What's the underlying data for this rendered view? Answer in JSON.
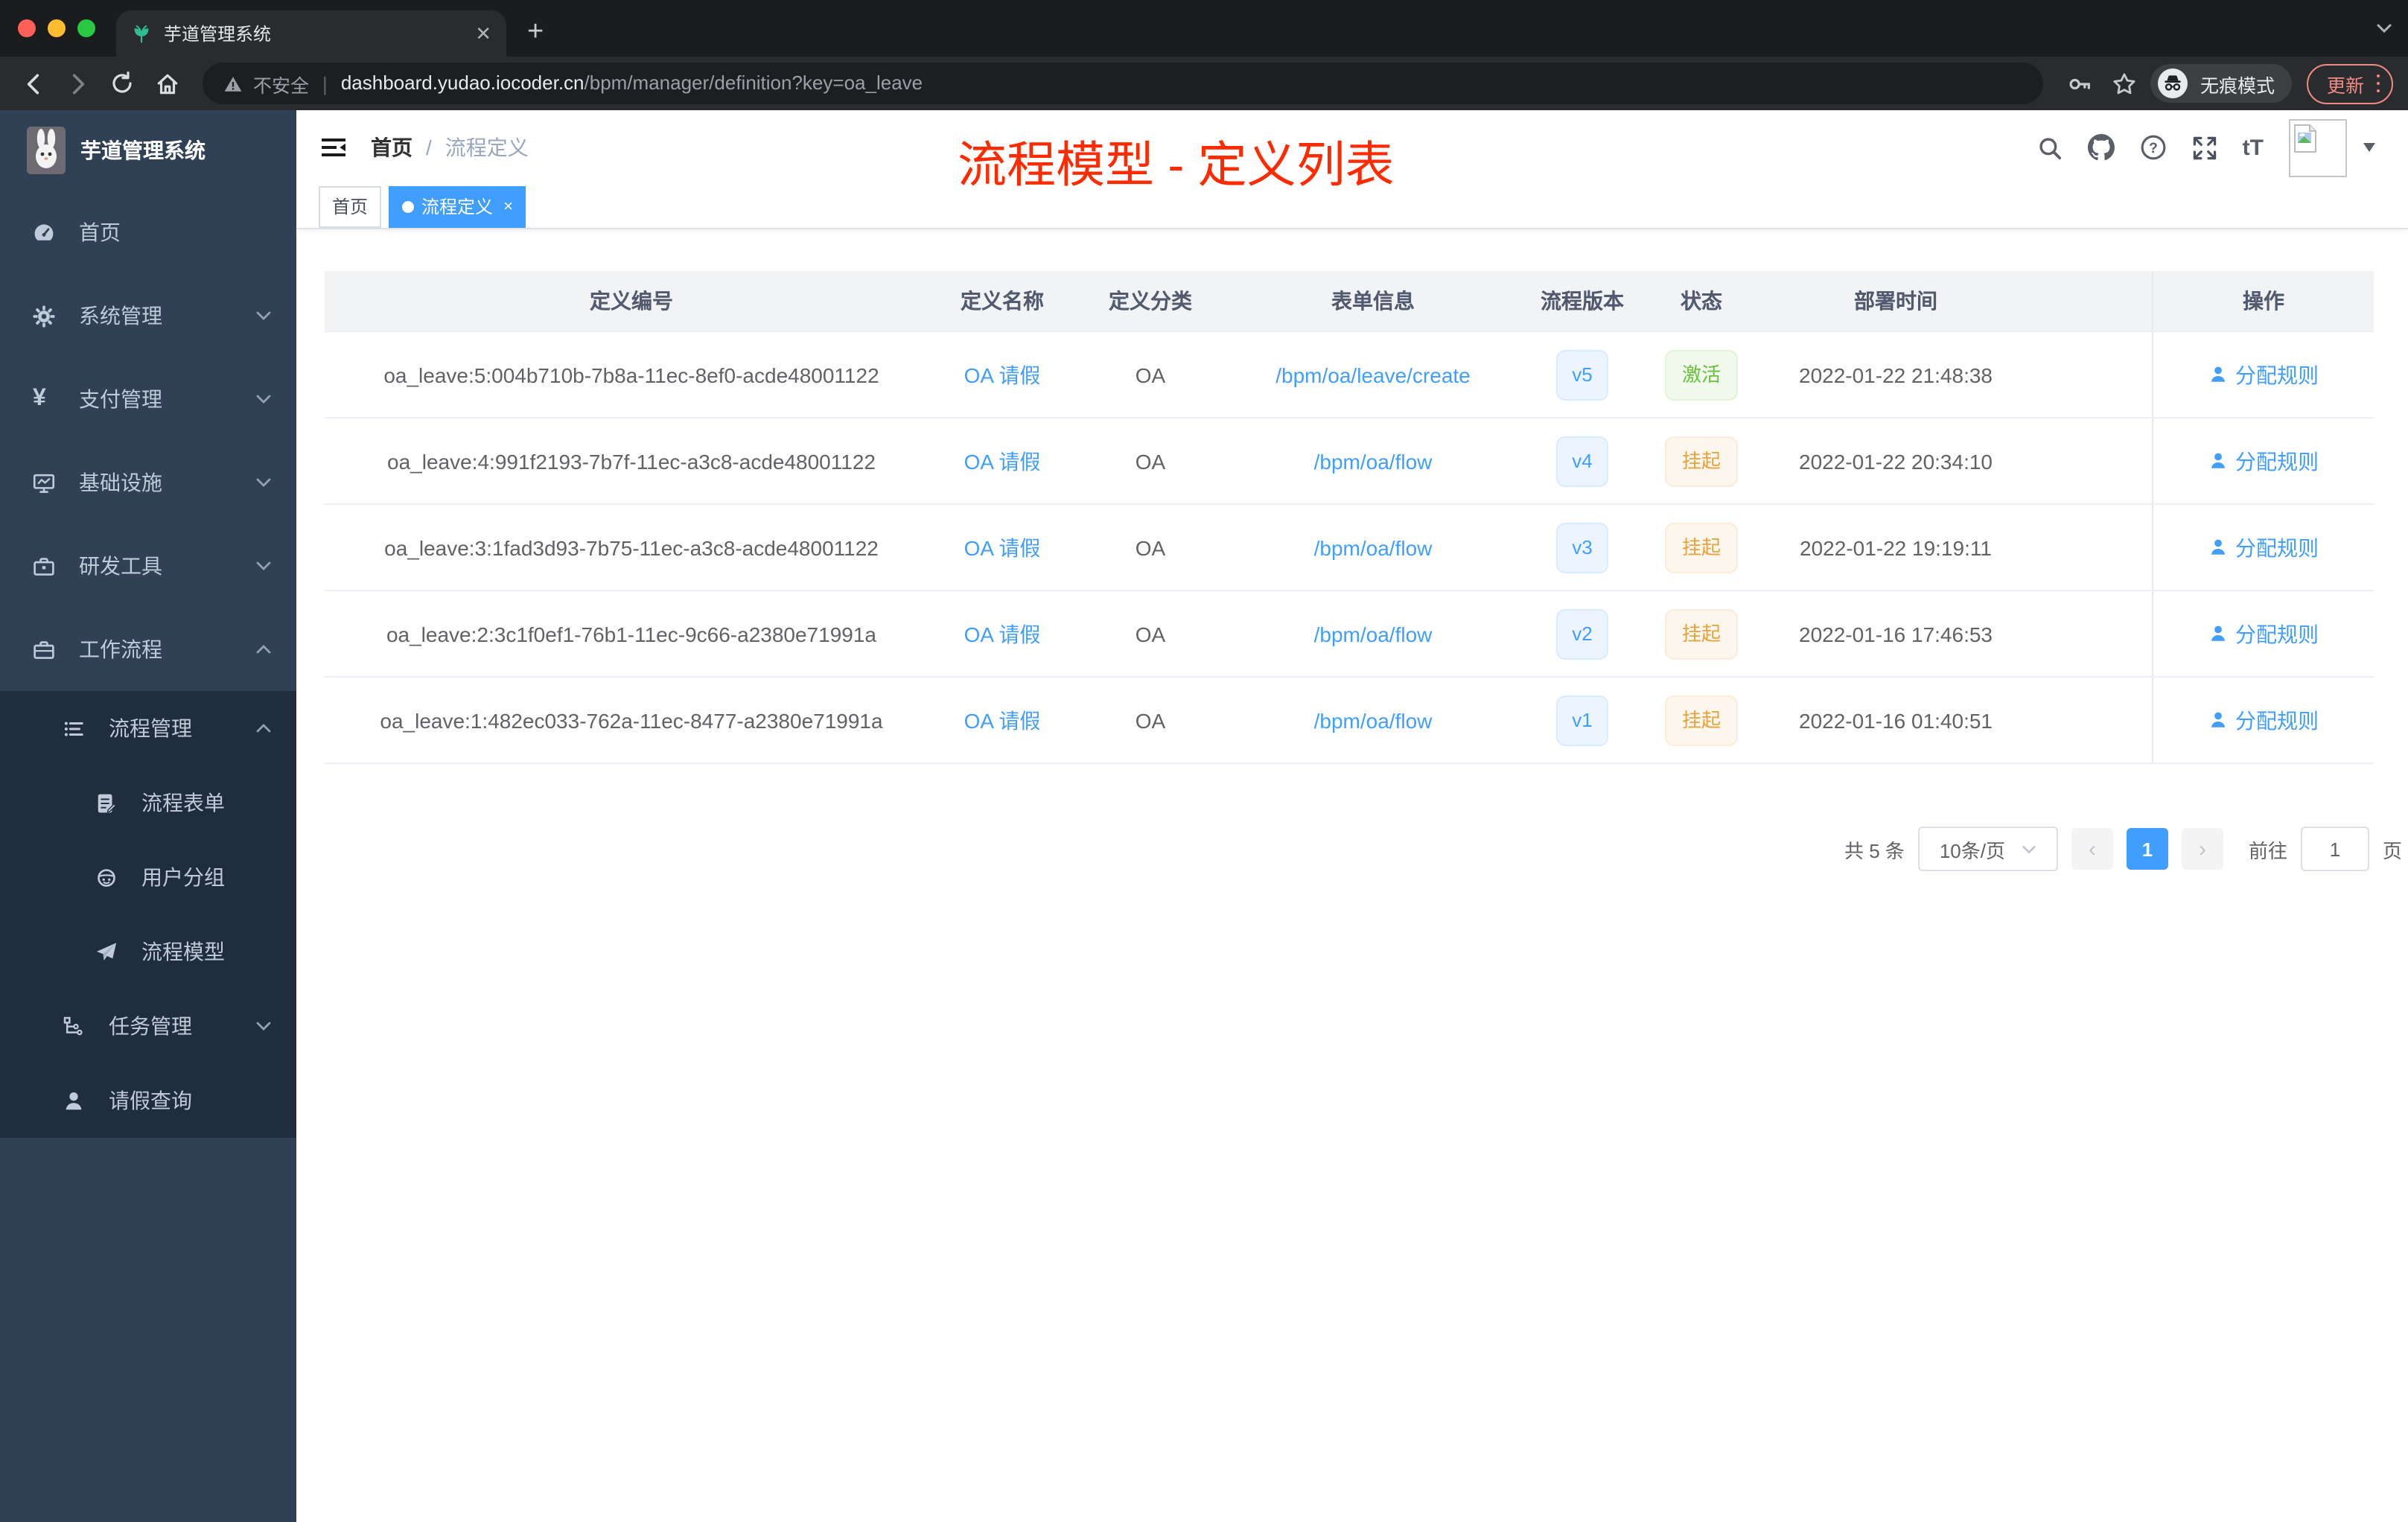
{
  "colors": {
    "accent": "#409eff",
    "annotation_red": "#ff2a00",
    "status_active_green": "#67c23a",
    "status_suspend_orange": "#e6a23c",
    "sidebar_bg": "#304156",
    "submenu_bg": "#1f2d3d"
  },
  "browser": {
    "tab_title": "芋道管理系统",
    "new_tab": "+",
    "security_warning": "不安全",
    "url_domain": "dashboard.yudao.iocoder.cn",
    "url_path": "/bpm/manager/definition?key=oa_leave",
    "incognito_label": "无痕模式",
    "update_label": "更新"
  },
  "sidebar": {
    "logo_title": "芋道管理系统",
    "items": [
      {
        "label": "首页",
        "icon": "dashboard-icon"
      },
      {
        "label": "系统管理",
        "icon": "gear-icon"
      },
      {
        "label": "支付管理",
        "icon": "yen-icon"
      },
      {
        "label": "基础设施",
        "icon": "monitor-icon"
      },
      {
        "label": "研发工具",
        "icon": "toolbox-icon"
      },
      {
        "label": "工作流程",
        "icon": "briefcase-icon"
      }
    ],
    "yen_glyph": "¥",
    "submenu": {
      "group_label": "流程管理",
      "children": [
        {
          "label": "流程表单",
          "icon": "form-icon"
        },
        {
          "label": "用户分组",
          "icon": "user-group-icon"
        },
        {
          "label": "流程模型",
          "icon": "paper-plane-icon"
        }
      ],
      "siblings": [
        {
          "label": "任务管理",
          "icon": "tree-icon"
        },
        {
          "label": "请假查询",
          "icon": "person-icon"
        }
      ]
    }
  },
  "navbar": {
    "breadcrumb": [
      "首页",
      "流程定义"
    ],
    "breadcrumb_separator": "/",
    "font_size_icon_label": "tT"
  },
  "annotation": {
    "text": "流程模型 - 定义列表"
  },
  "tags": [
    {
      "label": "首页"
    },
    {
      "label": "流程定义",
      "close": "×"
    }
  ],
  "table": {
    "headers": [
      "定义编号",
      "定义名称",
      "定义分类",
      "表单信息",
      "流程版本",
      "状态",
      "部署时间",
      "操作"
    ],
    "rows": [
      {
        "id": "oa_leave:5:004b710b-7b8a-11ec-8ef0-acde48001122",
        "name": "OA 请假",
        "category": "OA",
        "form": "/bpm/oa/leave/create",
        "version": "v5",
        "status": "激活",
        "status_type": "success",
        "deploy_time": "2022-01-22 21:48:38",
        "action": "分配规则"
      },
      {
        "id": "oa_leave:4:991f2193-7b7f-11ec-a3c8-acde48001122",
        "name": "OA 请假",
        "category": "OA",
        "form": "/bpm/oa/flow",
        "version": "v4",
        "status": "挂起",
        "status_type": "warning",
        "deploy_time": "2022-01-22 20:34:10",
        "action": "分配规则"
      },
      {
        "id": "oa_leave:3:1fad3d93-7b75-11ec-a3c8-acde48001122",
        "name": "OA 请假",
        "category": "OA",
        "form": "/bpm/oa/flow",
        "version": "v3",
        "status": "挂起",
        "status_type": "warning",
        "deploy_time": "2022-01-22 19:19:11",
        "action": "分配规则"
      },
      {
        "id": "oa_leave:2:3c1f0ef1-76b1-11ec-9c66-a2380e71991a",
        "name": "OA 请假",
        "category": "OA",
        "form": "/bpm/oa/flow",
        "version": "v2",
        "status": "挂起",
        "status_type": "warning",
        "deploy_time": "2022-01-16 17:46:53",
        "action": "分配规则"
      },
      {
        "id": "oa_leave:1:482ec033-762a-11ec-8477-a2380e71991a",
        "name": "OA 请假",
        "category": "OA",
        "form": "/bpm/oa/flow",
        "version": "v1",
        "status": "挂起",
        "status_type": "warning",
        "deploy_time": "2022-01-16 01:40:51",
        "action": "分配规则"
      }
    ]
  },
  "pagination": {
    "total": "共 5 条",
    "page_size": "10条/页",
    "prev": "‹",
    "page": "1",
    "next": "›",
    "jump_prefix": "前往",
    "jump_value": "1",
    "jump_suffix": "页"
  }
}
